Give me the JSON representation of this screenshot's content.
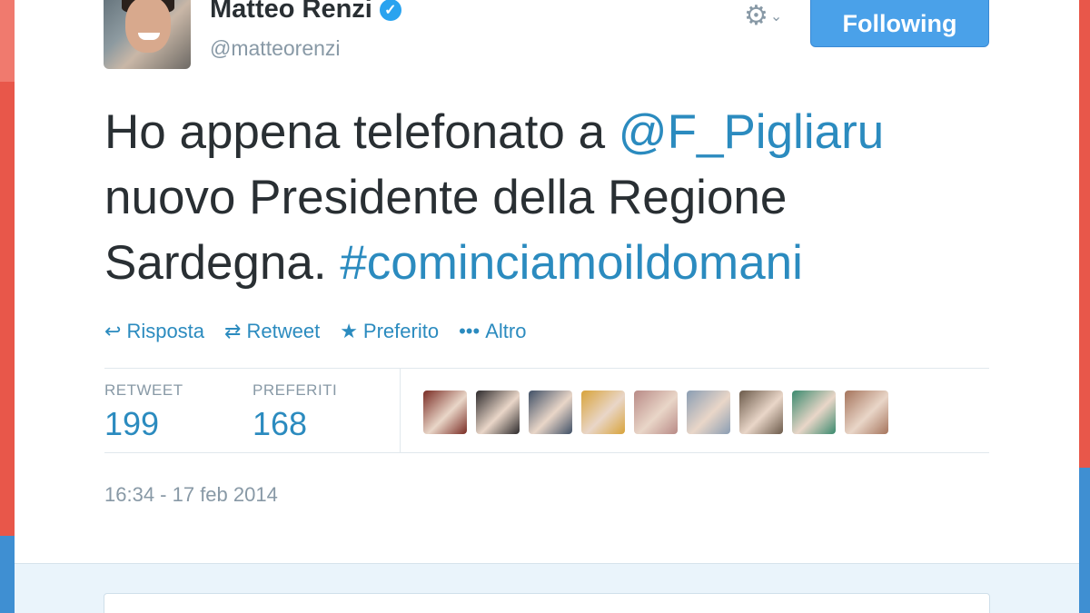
{
  "user": {
    "name": "Matteo Renzi",
    "handle": "@matteorenzi",
    "follow_label": "Following"
  },
  "tweet": {
    "text_part1": "Ho appena telefonato a ",
    "mention": "@F_Pigliaru",
    "text_part2": " nuovo Presidente della Regione Sardegna. ",
    "hashtag": "#cominciamoildomani"
  },
  "actions": [
    {
      "label": "Risposta",
      "icon": "reply-icon"
    },
    {
      "label": "Retweet",
      "icon": "retweet-icon"
    },
    {
      "label": "Preferito",
      "icon": "star-icon"
    },
    {
      "label": "Altro",
      "icon": "more-icon"
    }
  ],
  "stats": {
    "retweet_label": "RETWEET",
    "retweet_count": "199",
    "fav_label": "PREFERITI",
    "fav_count": "168"
  },
  "favoriters": [
    {
      "color": "#7a2c24"
    },
    {
      "color": "#2d2a2c"
    },
    {
      "color": "#3f4f66"
    },
    {
      "color": "#d8a33a"
    },
    {
      "color": "#b88a86"
    },
    {
      "color": "#8a9db3"
    },
    {
      "color": "#6b5a4a"
    },
    {
      "color": "#3a8a6e"
    },
    {
      "color": "#a5745c"
    }
  ],
  "timestamp": "16:34 - 17 feb 2014",
  "colors": {
    "accent": "#2b8bbf",
    "follow_button": "#4aa1e9"
  }
}
